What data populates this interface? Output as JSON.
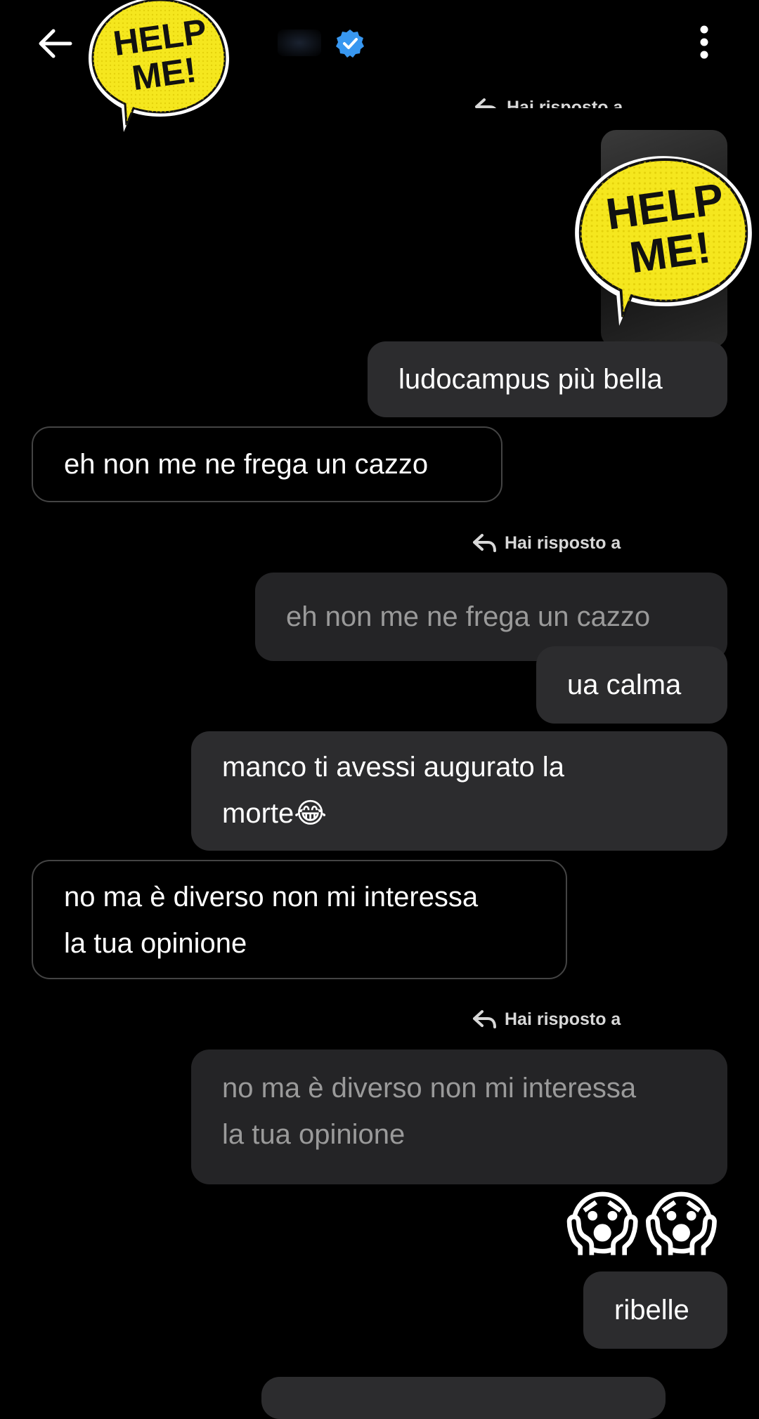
{
  "header": {
    "back_icon": "arrow-left-icon",
    "verified_icon": "verified-badge-icon",
    "more_icon": "more-vertical-icon"
  },
  "stickers": [
    {
      "name": "help-me-sticker",
      "text_line1": "HELP",
      "text_line2": "ME!"
    },
    {
      "name": "help-me-sticker",
      "text_line1": "HELP",
      "text_line2": "ME!"
    }
  ],
  "reply_notices": [
    {
      "label": "Hai risposto a"
    },
    {
      "label": "Hai risposto a"
    },
    {
      "label": "Hai risposto a"
    }
  ],
  "messages": [
    {
      "type": "outgoing",
      "text": "ludocampus più bella"
    },
    {
      "type": "incoming",
      "text": "eh non me ne frega un cazzo"
    },
    {
      "type": "quote",
      "text": "eh non me ne frega un cazzo"
    },
    {
      "type": "outgoing",
      "text": "ua calma"
    },
    {
      "type": "outgoing",
      "text_line1": "manco ti avessi augurato la",
      "text_line2": "morte"
    },
    {
      "type": "incoming",
      "text_line1": "no ma è diverso non mi interessa",
      "text_line2": "la tua opinione"
    },
    {
      "type": "quote",
      "text_line1": "no ma è diverso non mi interessa",
      "text_line2": "la tua opinione"
    },
    {
      "type": "outgoing",
      "text": "ribelle"
    }
  ],
  "emoji": {
    "laugh": "😂",
    "scream": "😱"
  },
  "colors": {
    "background": "#000000",
    "bubble_outgoing": "#2c2c2e",
    "bubble_quote": "#242426",
    "verified": "#3897f0",
    "sticker_yellow": "#f5e71e"
  }
}
